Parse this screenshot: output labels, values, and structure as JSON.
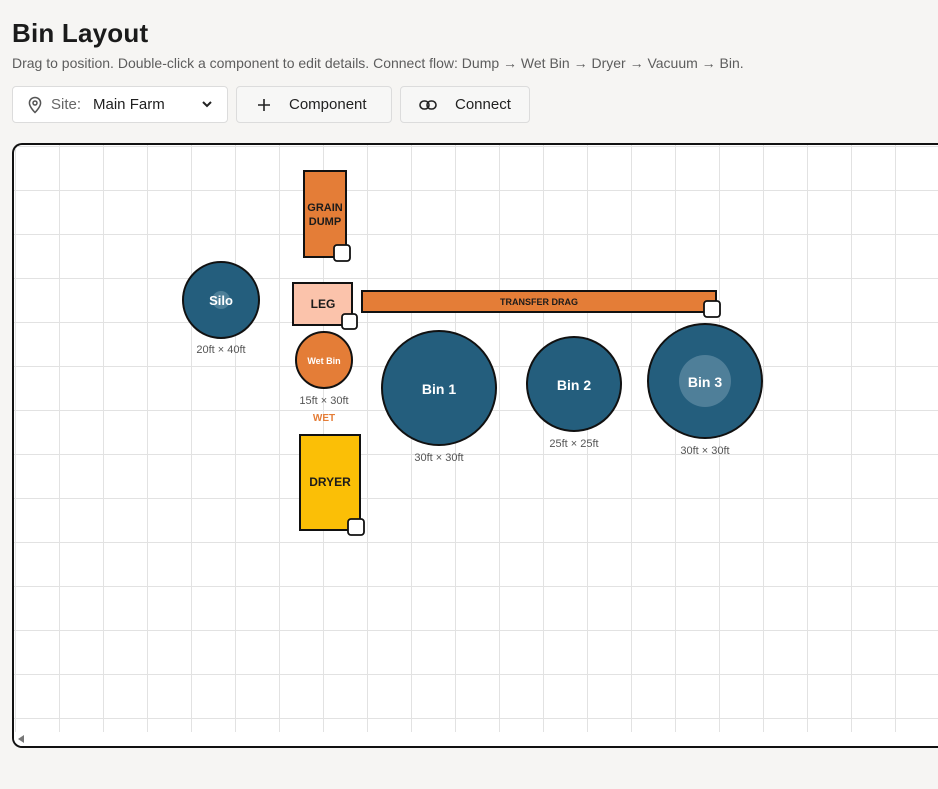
{
  "page": {
    "title": "Bin Layout",
    "subtitle": "Drag to position. Double-click a component to edit details. Connect flow: Dump → Wet Bin → Dryer → Vacuum → Bin."
  },
  "toolbar": {
    "site_label": "Site:",
    "site_value": "Main Farm",
    "component_label": "Component",
    "connect_label": "Connect"
  },
  "icons": {
    "site": "map-pin-icon",
    "site_dropdown": "chevron-down-icon",
    "component": "plus-icon",
    "connect": "link-icon"
  },
  "colors": {
    "bin_blue": "#245e7d",
    "orange": "#e47d37",
    "leg_pink": "#fbc3ab",
    "dryer_yellow": "#fbbf06",
    "wet_text": "#e47d37"
  },
  "components": {
    "silo": {
      "label": "Silo",
      "size": "20ft × 40ft"
    },
    "grain_dump": {
      "line1": "GRAIN",
      "line2": "DUMP"
    },
    "leg": {
      "label": "LEG"
    },
    "transfer_drag": {
      "label": "TRANSFER DRAG"
    },
    "wet_bin": {
      "label": "Wet Bin",
      "size": "15ft × 30ft",
      "tag": "WET"
    },
    "dryer": {
      "label": "DRYER"
    },
    "bin1": {
      "label": "Bin 1",
      "size": "30ft × 30ft"
    },
    "bin2": {
      "label": "Bin 2",
      "size": "25ft × 25ft"
    },
    "bin3": {
      "label": "Bin 3",
      "size": "30ft × 30ft"
    }
  }
}
